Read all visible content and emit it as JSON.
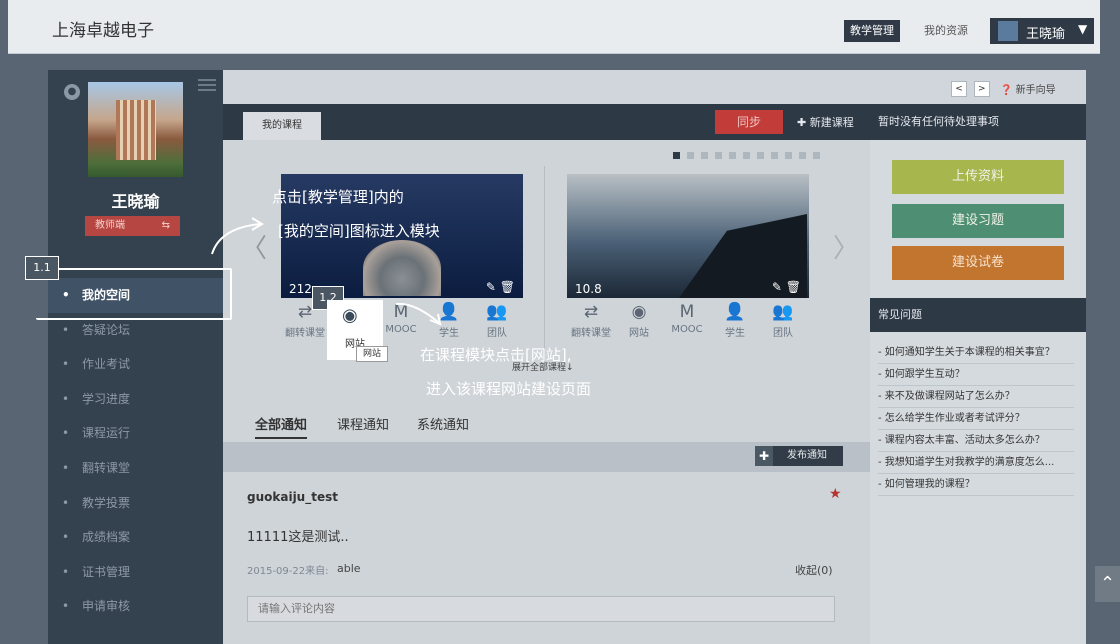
{
  "header": {
    "brand": "上海卓越电子",
    "nav_teaching": "教学管理",
    "nav_resources": "我的资源",
    "user_name": "王晓瑜"
  },
  "sidebar": {
    "name": "王晓瑜",
    "role": "教师端",
    "items": [
      {
        "label": "我的空间"
      },
      {
        "label": "答疑论坛"
      },
      {
        "label": "作业考试"
      },
      {
        "label": "学习进度"
      },
      {
        "label": "课程运行"
      },
      {
        "label": "翻转课堂"
      },
      {
        "label": "教学投票"
      },
      {
        "label": "成绩档案"
      },
      {
        "label": "证书管理"
      },
      {
        "label": "申请审核"
      }
    ]
  },
  "toolbar": {
    "prev": "<",
    "next": ">",
    "guide": "新手向导"
  },
  "courses": {
    "tab": "我的课程",
    "sync": "同步",
    "new_course": "新建课程",
    "cards": [
      {
        "number": "212",
        "icons": [
          "翻转课堂",
          "网站",
          "MOOC",
          "学生",
          "团队"
        ]
      },
      {
        "number": "10.8",
        "icons": [
          "翻转课堂",
          "网站",
          "MOOC",
          "学生",
          "团队"
        ]
      }
    ],
    "tooltip": "网站",
    "expand": "展开全部课程↓"
  },
  "notices": {
    "tabs": [
      "全部通知",
      "课程通知",
      "系统通知"
    ],
    "post_button": "发布通知",
    "item": {
      "author": "guokaiju_test",
      "body": "11111这是测试..",
      "date": "2015-09-22来自:",
      "from": "able",
      "collapse": "收起(0)",
      "comment_placeholder": "请输入评论内容"
    }
  },
  "right_panel": {
    "pending": "暂时没有任何待处理事项",
    "upload": "上传资料",
    "exercise": "建设习题",
    "exam": "建设试卷",
    "faq_title": "常见问题",
    "faq": [
      "- 如何通知学生关于本课程的相关事宜？",
      "- 如何跟学生互动？",
      "- 来不及做课程网站了怎么办？",
      "- 怎么给学生作业或者考试评分？",
      "- 课程内容太丰富、活动太多怎么办？",
      "- 我想知道学生对我教学的满意度怎么...",
      "- 如何管理我的课程？"
    ]
  },
  "overlay": {
    "step1": "1.1",
    "step2": "1.2",
    "text1_line1": "点击[教学管理]内的",
    "text1_line2": "[我的空间]图标进入模块",
    "text2_line1": "在课程模块点击[网站],",
    "text2_line2": "进入该课程网站建设页面"
  },
  "colors": {
    "sidebar_bg": "#34414e",
    "accent_red": "#c23d3a",
    "upload_green": "#a8b64e",
    "exercise_teal": "#4e8e72",
    "exam_orange": "#c2752f"
  }
}
